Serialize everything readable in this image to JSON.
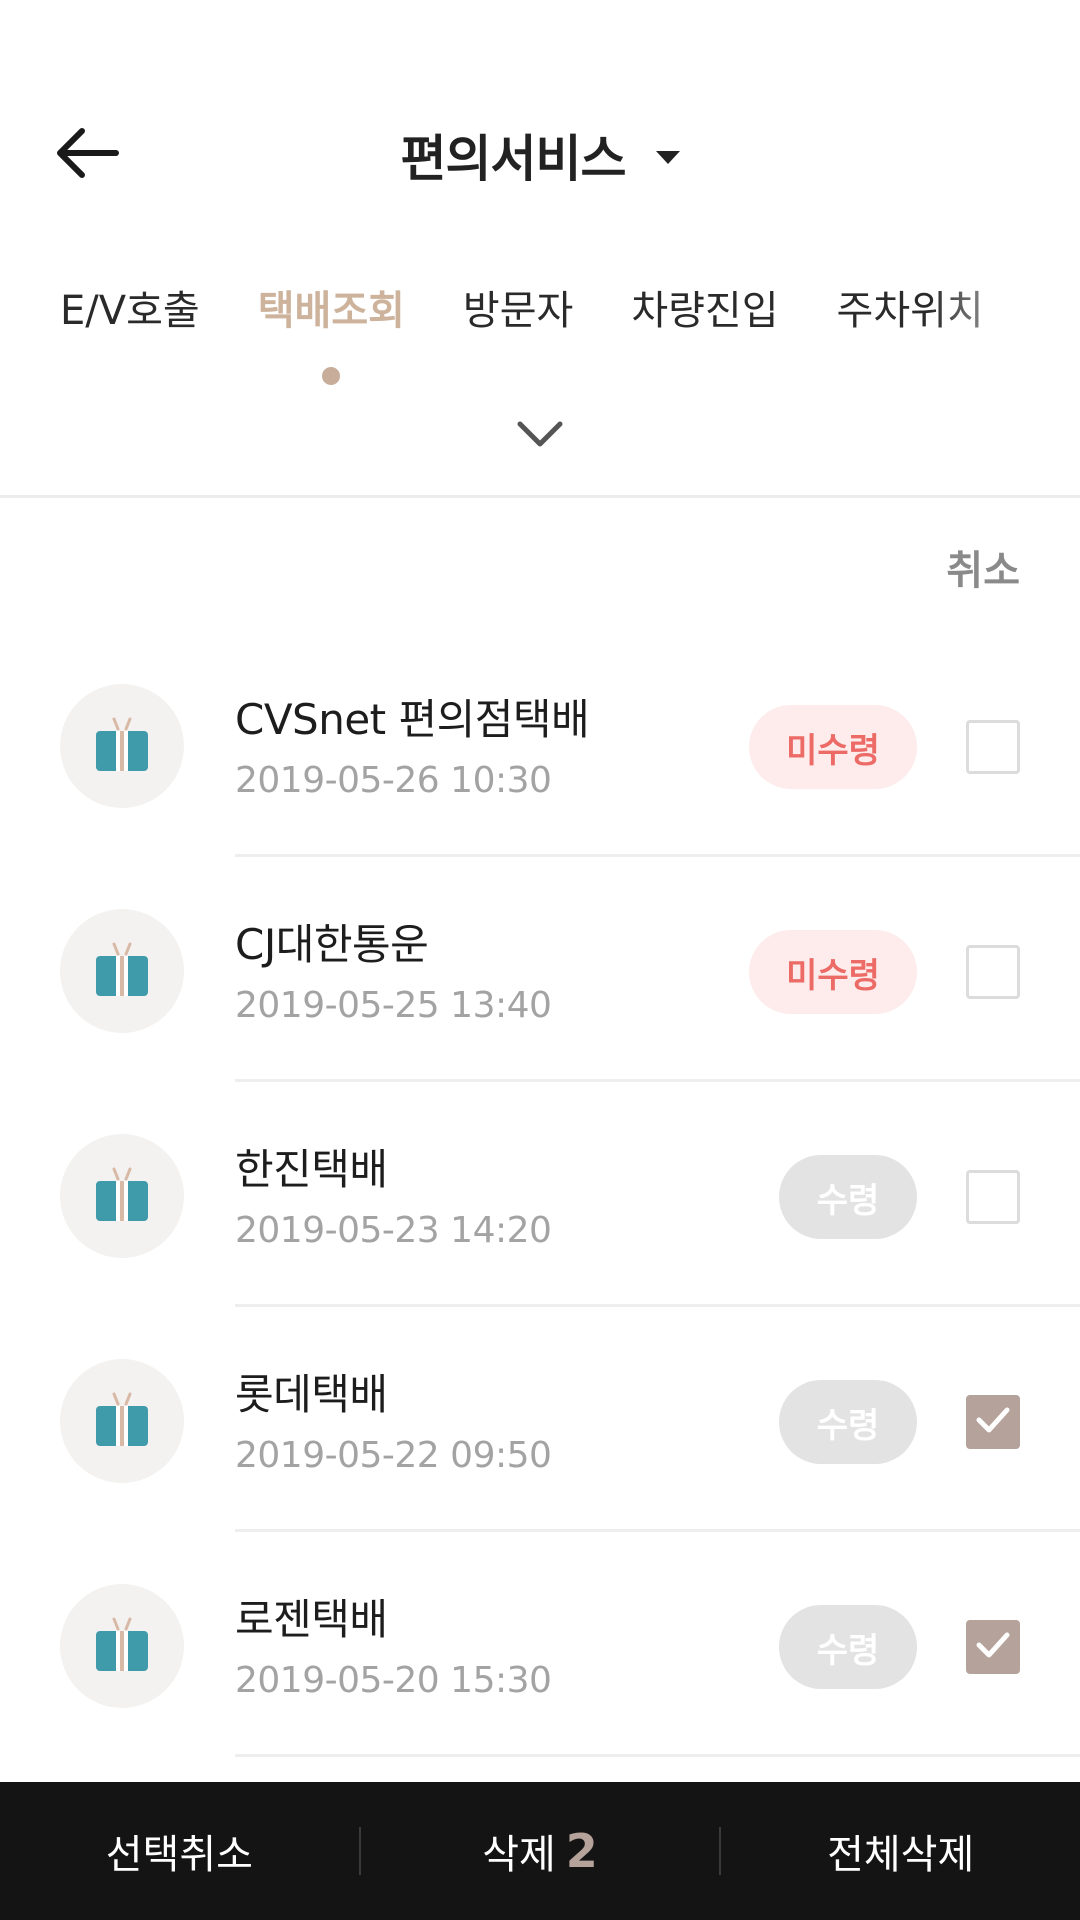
{
  "header": {
    "title": "편의서비스",
    "back_icon": "arrow-left-icon",
    "dropdown_icon": "caret-down-icon"
  },
  "tabs": [
    {
      "label": "E/V호출",
      "active": false
    },
    {
      "label": "택배조회",
      "active": true
    },
    {
      "label": "방문자",
      "active": false
    },
    {
      "label": "차량진입",
      "active": false
    },
    {
      "label": "주차위치",
      "active": false
    }
  ],
  "expand_icon": "chevron-down-icon",
  "cancel_label": "취소",
  "packages": [
    {
      "name": "CVSnet 편의점택배",
      "datetime": "2019-05-26 10:30",
      "status": "미수령",
      "received": false,
      "checked": false
    },
    {
      "name": "CJ대한통운",
      "datetime": "2019-05-25 13:40",
      "status": "미수령",
      "received": false,
      "checked": false
    },
    {
      "name": "한진택배",
      "datetime": "2019-05-23 14:20",
      "status": "수령",
      "received": true,
      "checked": false
    },
    {
      "name": "롯데택배",
      "datetime": "2019-05-22 09:50",
      "status": "수령",
      "received": true,
      "checked": true
    },
    {
      "name": "로젠택배",
      "datetime": "2019-05-20 15:30",
      "status": "수령",
      "received": true,
      "checked": true
    }
  ],
  "bottom_bar": {
    "deselect_label": "선택취소",
    "delete_label": "삭제",
    "delete_count": "2",
    "delete_all_label": "전체삭제"
  },
  "colors": {
    "accent": "#cdb29c",
    "checked": "#b5a29a",
    "unreceived_text": "#ec6b66",
    "unreceived_bg": "#fdeceb",
    "received_bg": "#e3e3e3",
    "gift_teal": "#3f9aa9",
    "gift_ribbon": "#d8b9a6",
    "bottom_bar_bg": "#141414"
  }
}
